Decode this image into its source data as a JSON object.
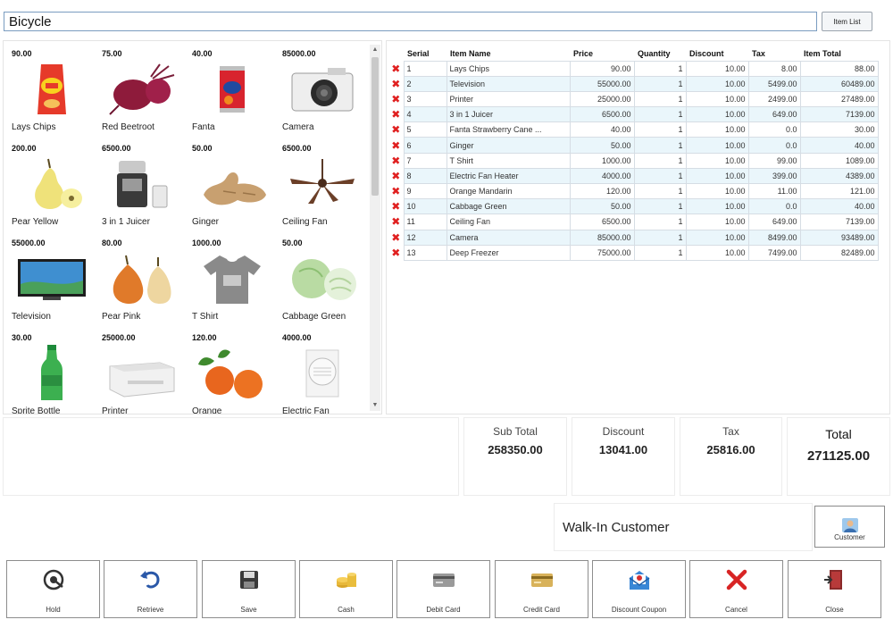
{
  "search": {
    "value": "Bicycle"
  },
  "item_list_button": "Item List",
  "products": [
    {
      "price": "90.00",
      "name": "Lays Chips",
      "icon": "chips-bag-icon"
    },
    {
      "price": "75.00",
      "name": "Red Beetroot",
      "icon": "beetroot-icon"
    },
    {
      "price": "40.00",
      "name": "Fanta",
      "icon": "soda-can-icon"
    },
    {
      "price": "85000.00",
      "name": "Camera",
      "icon": "camera-icon"
    },
    {
      "price": "200.00",
      "name": "Pear Yellow",
      "icon": "pear-icon"
    },
    {
      "price": "6500.00",
      "name": "3 in 1 Juicer",
      "icon": "juicer-icon"
    },
    {
      "price": "50.00",
      "name": "Ginger",
      "icon": "ginger-icon"
    },
    {
      "price": "6500.00",
      "name": "Ceiling Fan",
      "icon": "ceiling-fan-icon"
    },
    {
      "price": "55000.00",
      "name": "Television",
      "icon": "television-icon"
    },
    {
      "price": "80.00",
      "name": "Pear Pink",
      "icon": "pear-icon"
    },
    {
      "price": "1000.00",
      "name": "T Shirt",
      "icon": "tshirt-icon"
    },
    {
      "price": "50.00",
      "name": "Cabbage Green",
      "icon": "cabbage-icon"
    },
    {
      "price": "30.00",
      "name": "Sprite Bottle",
      "icon": "bottle-icon"
    },
    {
      "price": "25000.00",
      "name": "Printer",
      "icon": "printer-icon"
    },
    {
      "price": "120.00",
      "name": "Orange",
      "icon": "orange-icon"
    },
    {
      "price": "4000.00",
      "name": "Electric Fan",
      "icon": "electric-fan-icon"
    }
  ],
  "order_table": {
    "headers": [
      "Serial",
      "Item Name",
      "Price",
      "Quantity",
      "Discount",
      "Tax",
      "Item Total"
    ],
    "rows": [
      [
        "1",
        "Lays Chips",
        "90.00",
        "1",
        "10.00",
        "8.00",
        "88.00"
      ],
      [
        "2",
        "Television",
        "55000.00",
        "1",
        "10.00",
        "5499.00",
        "60489.00"
      ],
      [
        "3",
        "Printer",
        "25000.00",
        "1",
        "10.00",
        "2499.00",
        "27489.00"
      ],
      [
        "4",
        "3 in 1 Juicer",
        "6500.00",
        "1",
        "10.00",
        "649.00",
        "7139.00"
      ],
      [
        "5",
        "Fanta Strawberry Cane ...",
        "40.00",
        "1",
        "10.00",
        "0.0",
        "30.00"
      ],
      [
        "6",
        "Ginger",
        "50.00",
        "1",
        "10.00",
        "0.0",
        "40.00"
      ],
      [
        "7",
        "T Shirt",
        "1000.00",
        "1",
        "10.00",
        "99.00",
        "1089.00"
      ],
      [
        "8",
        "Electric Fan Heater",
        "4000.00",
        "1",
        "10.00",
        "399.00",
        "4389.00"
      ],
      [
        "9",
        "Orange Mandarin",
        "120.00",
        "1",
        "10.00",
        "11.00",
        "121.00"
      ],
      [
        "10",
        "Cabbage Green",
        "50.00",
        "1",
        "10.00",
        "0.0",
        "40.00"
      ],
      [
        "11",
        "Ceiling Fan",
        "6500.00",
        "1",
        "10.00",
        "649.00",
        "7139.00"
      ],
      [
        "12",
        "Camera",
        "85000.00",
        "1",
        "10.00",
        "8499.00",
        "93489.00"
      ],
      [
        "13",
        "Deep Freezer",
        "75000.00",
        "1",
        "10.00",
        "7499.00",
        "82489.00"
      ]
    ]
  },
  "totals": {
    "sub_total_label": "Sub Total",
    "sub_total": "258350.00",
    "discount_label": "Discount",
    "discount": "13041.00",
    "tax_label": "Tax",
    "tax": "25816.00",
    "total_label": "Total",
    "total": "271125.00"
  },
  "customer": {
    "name": "Walk-In Customer",
    "button_label": "Customer"
  },
  "actions": [
    {
      "label": "Hold",
      "icon": "hold-icon"
    },
    {
      "label": "Retrieve",
      "icon": "retrieve-icon"
    },
    {
      "label": "Save",
      "icon": "save-icon"
    },
    {
      "label": "Cash",
      "icon": "cash-icon"
    },
    {
      "label": "Debit Card",
      "icon": "debit-card-icon"
    },
    {
      "label": "Credit Card",
      "icon": "credit-card-icon"
    },
    {
      "label": "Discount Coupon",
      "icon": "coupon-icon"
    },
    {
      "label": "Cancel",
      "icon": "cancel-icon"
    },
    {
      "label": "Close",
      "icon": "close-door-icon"
    }
  ],
  "colors": {
    "accent_border": "#7a9cc0",
    "row_alt": "#eaf6fb",
    "delete_red": "#e02020",
    "coupon_blue": "#3a87d6"
  }
}
